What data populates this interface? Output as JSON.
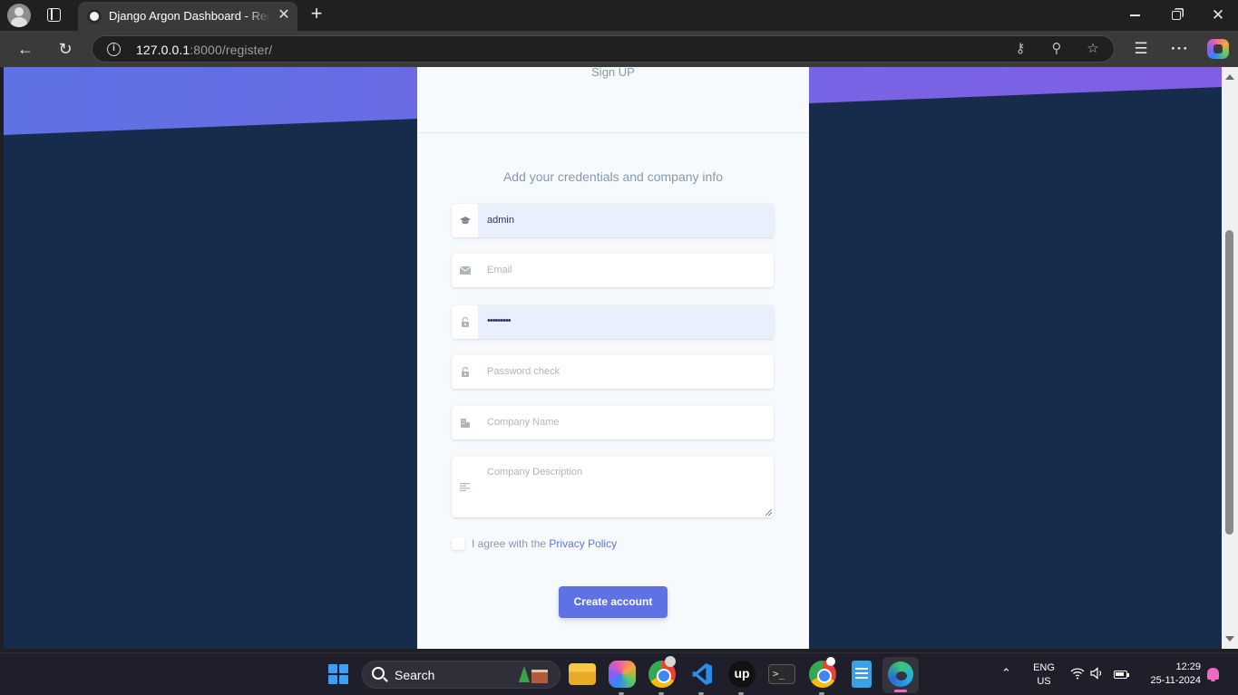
{
  "browser": {
    "tab_title": "Django Argon Dashboard - Register",
    "tab_close": "✕",
    "new_tab": "+",
    "url_host": "127.0.0.1",
    "url_rest": ":8000/register/",
    "icons": [
      "profile-icon",
      "tab-actions-icon",
      "back-icon",
      "refresh-icon",
      "site-info-icon",
      "password-key-icon",
      "zoom-out-icon",
      "favorite-star-icon",
      "favorites-icon",
      "more-icon",
      "copilot-icon"
    ]
  },
  "page": {
    "colors": {
      "hero_start": "#5e72e4",
      "hero_end": "#825ee4",
      "background": "#172b4d",
      "primary": "#5e72e4"
    },
    "header": "Sign UP",
    "subtitle": "Add your credentials and company info",
    "fields": {
      "username": {
        "value": "admin",
        "icon": "graduation-cap-icon"
      },
      "email": {
        "placeholder": "Email",
        "icon": "envelope-icon"
      },
      "password": {
        "value": "•••••••••",
        "icon": "lock-icon"
      },
      "password_check": {
        "placeholder": "Password check",
        "icon": "lock-icon"
      },
      "company_name": {
        "placeholder": "Company Name",
        "icon": "building-icon"
      },
      "company_description": {
        "placeholder": "Company Description",
        "icon": "align-left-icon"
      }
    },
    "agree_text": "I agree with the",
    "privacy_link": "Privacy Policy",
    "submit_label": "Create account"
  },
  "taskbar": {
    "search_label": "Search",
    "apps": [
      "file-explorer-icon",
      "copilot-icon",
      "chrome-icon",
      "vscode-icon",
      "upwork-icon",
      "terminal-icon",
      "chrome-profile-icon",
      "notepad-icon",
      "edge-icon"
    ],
    "terminal_glyph": ">_",
    "up_glyph": "up",
    "lang_primary": "ENG",
    "lang_secondary": "US",
    "time": "12:29",
    "date": "25-11-2024"
  }
}
